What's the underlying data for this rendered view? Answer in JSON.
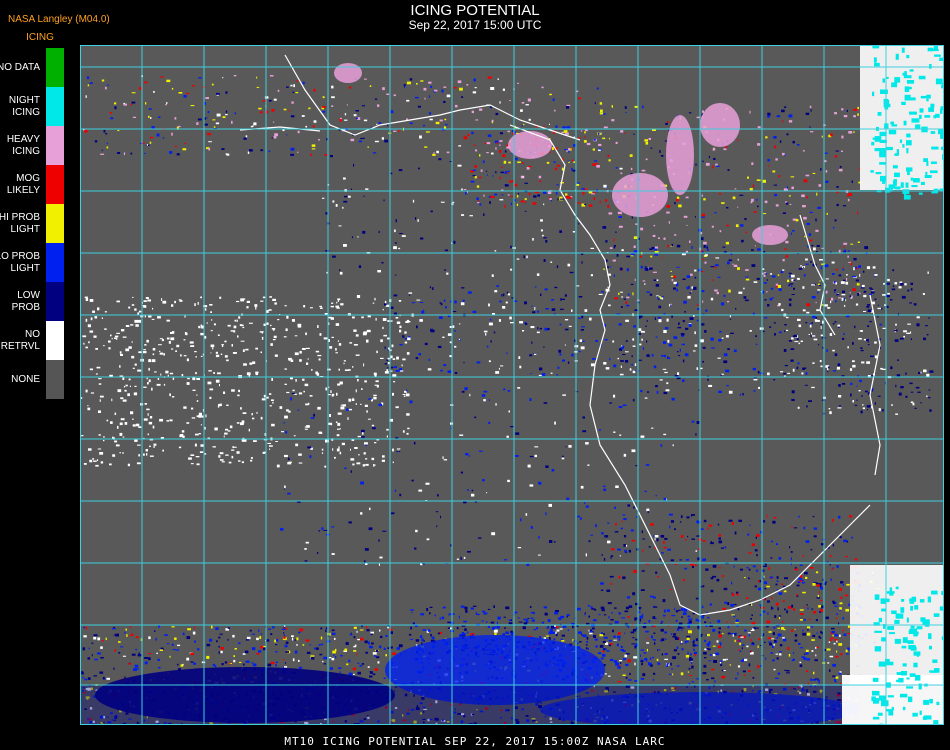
{
  "header": {
    "source": "NASA Langley (M04.0)",
    "product": "ICING",
    "title": "ICING POTENTIAL",
    "subtitle": "Sep 22, 2017 15:00 UTC"
  },
  "legend": [
    {
      "label": "NO DATA",
      "color": "#00b000"
    },
    {
      "label": "NIGHT\nICING",
      "color": "#00e8e8"
    },
    {
      "label": "HEAVY\nICING",
      "color": "#e8a0d8"
    },
    {
      "label": "MOG\nLIKELY",
      "color": "#ee0000"
    },
    {
      "label": "HI PROB\nLIGHT",
      "color": "#f0f000"
    },
    {
      "label": "LO PROB\nLIGHT",
      "color": "#0020f0"
    },
    {
      "label": "LOW\nPROB",
      "color": "#000080"
    },
    {
      "label": "NO\nRETRVL",
      "color": "#ffffff"
    },
    {
      "label": "NONE",
      "color": "#555555"
    }
  ],
  "map": {
    "background": "#595959",
    "grid_color": "#40d0e0",
    "coast_color": "#ffffff",
    "grid_label_color": "#c00000"
  },
  "footer": "MT10  ICING POTENTIAL   SEP 22, 2017 15:00Z   NASA LARC"
}
